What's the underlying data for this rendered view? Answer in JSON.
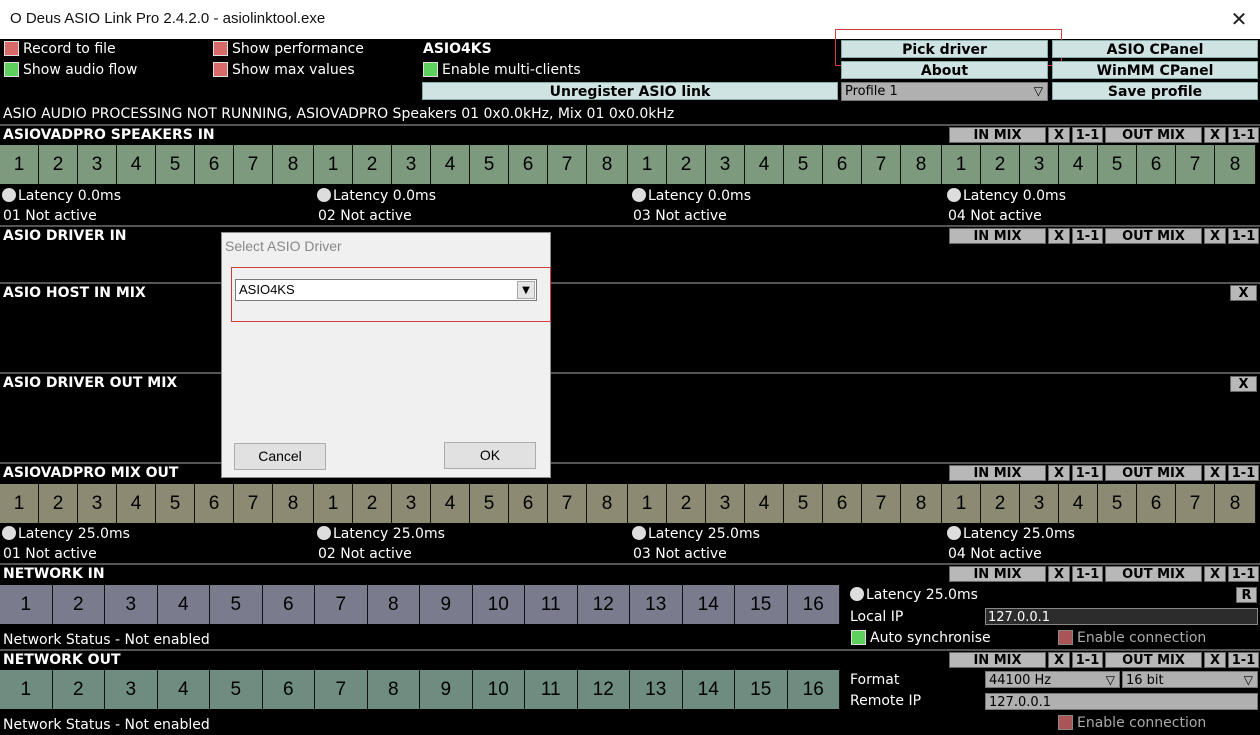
{
  "window": {
    "title": "O Deus ASIO Link Pro 2.4.2.0 - asiolinktool.exe",
    "close_glyph": "✕"
  },
  "top": {
    "record_to_file": "Record to file",
    "show_performance": "Show performance",
    "show_audio_flow": "Show audio flow",
    "show_max_values": "Show max values",
    "driver_name": "ASIO4KS",
    "enable_multi_clients": "Enable multi-clients",
    "unregister": "Unregister ASIO link",
    "pick_driver": "Pick driver",
    "asio_cpanel": "ASIO CPanel",
    "about": "About",
    "winmm_cpanel": "WinMM CPanel",
    "profile": "Profile 1",
    "save_profile": "Save profile"
  },
  "status_line": "ASIO AUDIO PROCESSING NOT RUNNING, ASIOVADPRO Speakers 01 0x0.0kHz, Mix 01 0x0.0kHz",
  "mix_buttons": {
    "in_mix": "IN MIX",
    "x": "X",
    "one_one": "1-1",
    "out_mix": "OUT MIX"
  },
  "sections": {
    "speakers_in": {
      "title": "ASIOVADPRO SPEAKERS IN",
      "groups": [
        {
          "latency": "Latency 0.0ms",
          "status": "01 Not active"
        },
        {
          "latency": "Latency 0.0ms",
          "status": "02 Not active"
        },
        {
          "latency": "Latency 0.0ms",
          "status": "03 Not active"
        },
        {
          "latency": "Latency 0.0ms",
          "status": "04 Not active"
        }
      ]
    },
    "driver_in": {
      "title": "ASIO DRIVER IN"
    },
    "host_in_mix": {
      "title": "ASIO HOST IN MIX"
    },
    "driver_out_mix": {
      "title": "ASIO DRIVER OUT MIX"
    },
    "mix_out": {
      "title": "ASIOVADPRO MIX OUT",
      "groups": [
        {
          "latency": "Latency 25.0ms",
          "status": "01 Not active"
        },
        {
          "latency": "Latency 25.0ms",
          "status": "02 Not active"
        },
        {
          "latency": "Latency 25.0ms",
          "status": "03 Not active"
        },
        {
          "latency": "Latency 25.0ms",
          "status": "04 Not active"
        }
      ]
    },
    "network_in": {
      "title": "NETWORK IN",
      "status": "Network Status - Not enabled",
      "latency": "Latency 25.0ms",
      "r_button": "R",
      "local_ip_label": "Local IP",
      "local_ip": "127.0.0.1",
      "auto_sync": "Auto synchronise",
      "enable_connection": "Enable connection"
    },
    "network_out": {
      "title": "NETWORK OUT",
      "status": "Network Status - Not enabled",
      "format_label": "Format",
      "sample_rate": "44100 Hz",
      "bit_depth": "16 bit",
      "remote_ip_label": "Remote IP",
      "remote_ip": "127.0.0.1",
      "enable_connection": "Enable connection"
    }
  },
  "channels8": [
    "1",
    "2",
    "3",
    "4",
    "5",
    "6",
    "7",
    "8"
  ],
  "channels16": [
    "1",
    "2",
    "3",
    "4",
    "5",
    "6",
    "7",
    "8",
    "9",
    "10",
    "11",
    "12",
    "13",
    "14",
    "15",
    "16"
  ],
  "dialog": {
    "title": "Select ASIO Driver",
    "selected_driver": "ASIO4KS",
    "cancel": "Cancel",
    "ok": "OK"
  },
  "colors": {
    "speakers_channel": "#7e9a7e",
    "mixout_channel": "#8c8a72",
    "network_in_channel": "#7a7c8e",
    "network_out_channel": "#6e8c80",
    "annotation": "#d23c3c"
  }
}
